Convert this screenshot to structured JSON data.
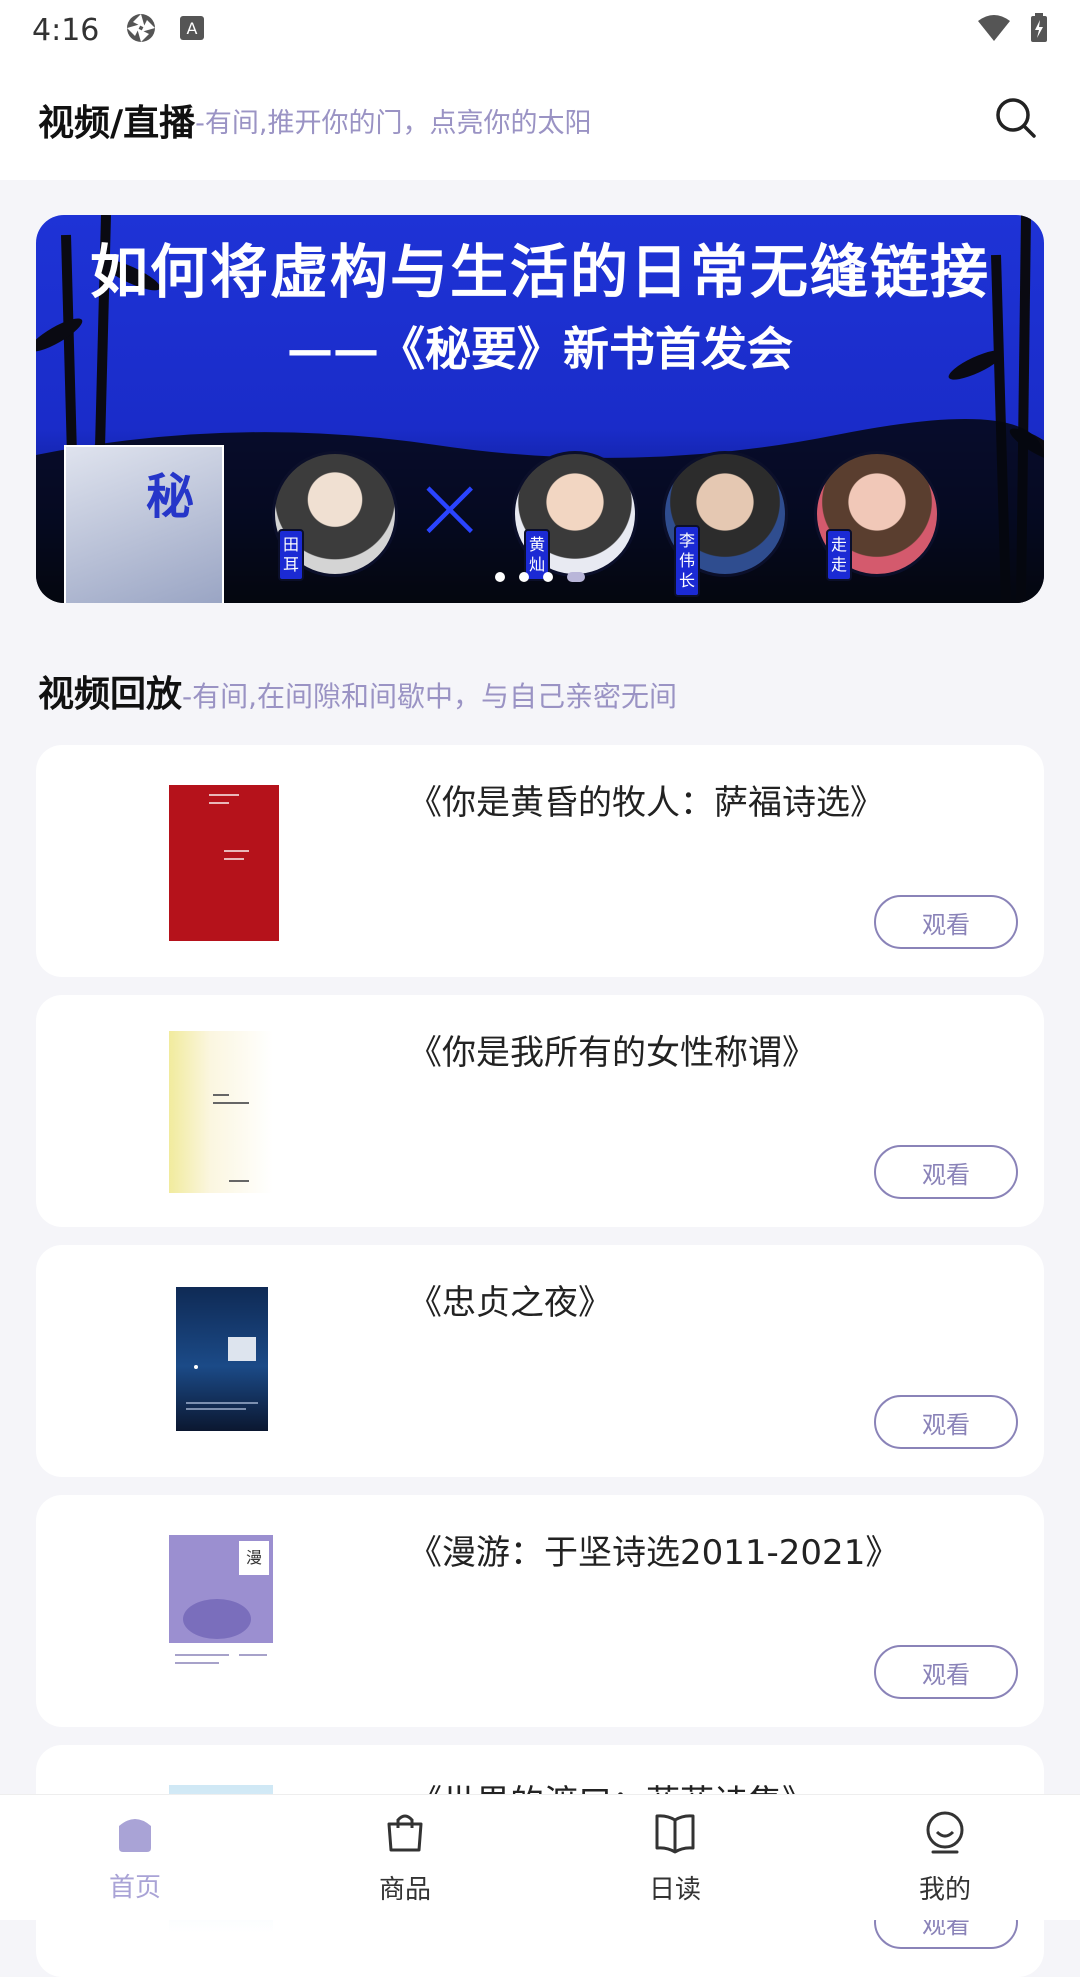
{
  "status_bar": {
    "time": "4:16",
    "icons_left": [
      "aperture-icon",
      "text-a-icon"
    ],
    "icons_right": [
      "wifi-icon",
      "battery-icon"
    ]
  },
  "header": {
    "title": "视频/直播",
    "subtitle": "-有间,推开你的门，点亮你的太阳",
    "search_icon": "search-icon"
  },
  "banner": {
    "title": "如何将虚构与生活的日常无缝链接",
    "subtitle": "——《秘要》新书首发会",
    "book_char": "秘",
    "x_mark": "×",
    "name_tags": [
      "田耳",
      "黄灿",
      "李伟长",
      "走走"
    ],
    "slide_count": 4,
    "active_slide": 4
  },
  "section": {
    "title": "视频回放",
    "subtitle": "-有间,在间隙和间歇中，与自己亲密无间"
  },
  "videos": [
    {
      "title": "《你是黄昏的牧人：萨福诗选》",
      "button": "观看"
    },
    {
      "title": "《你是我所有的女性称谓》",
      "button": "观看"
    },
    {
      "title": "《忠贞之夜》",
      "button": "观看"
    },
    {
      "title": "《漫游：于坚诗选2011-2021》",
      "button": "观看"
    },
    {
      "title": "《世界的渡口：蓝蓝诗集》",
      "button": "观看"
    }
  ],
  "tabbar": {
    "items": [
      {
        "label": "首页",
        "icon": "home-icon",
        "active": true
      },
      {
        "label": "商品",
        "icon": "shopping-bag-icon",
        "active": false
      },
      {
        "label": "日读",
        "icon": "book-icon",
        "active": false
      },
      {
        "label": "我的",
        "icon": "profile-icon",
        "active": false
      }
    ]
  },
  "colors": {
    "accent": "#9a93c4",
    "button_border": "#8a83b8",
    "tab_active": "#a9a3d6",
    "banner_blue": "#1e33d6"
  }
}
